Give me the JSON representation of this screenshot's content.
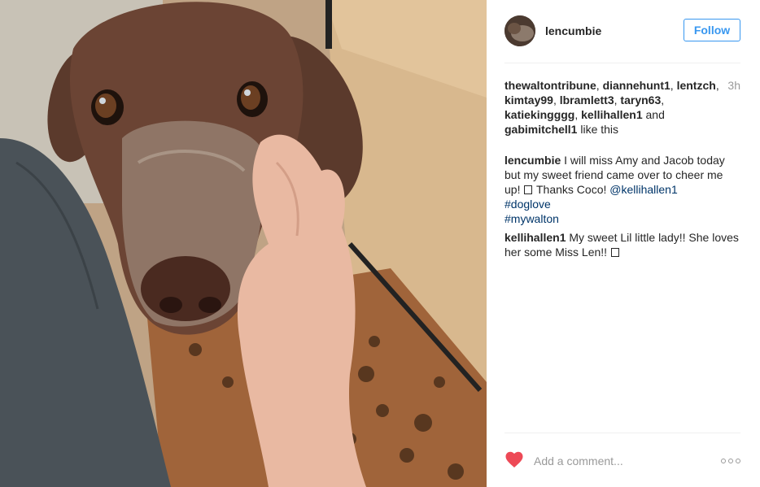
{
  "post": {
    "username": "lencumbie",
    "follow_label": "Follow",
    "time": "3h",
    "likes": {
      "users": [
        "thewaltontribune",
        "diannehunt1",
        "lentzch",
        "kimtay99",
        "lbramlett3",
        "taryn63",
        "katiekingggg",
        "kellihallen1",
        "gabimitchell1"
      ],
      "connector": "and",
      "suffix": "like this"
    },
    "caption": {
      "username": "lencumbie",
      "text_before": "I will miss Amy and Jacob today but my sweet friend came over to cheer me up!",
      "text_after": "Thanks Coco!",
      "mention": "@kellihallen1",
      "hashtags": [
        "#doglove",
        "#mywalton"
      ]
    },
    "comments": [
      {
        "username": "kellihallen1",
        "text": "My sweet Lil little lady!! She loves her some Miss Len!!"
      }
    ],
    "add_comment_placeholder": "Add a comment...",
    "colors": {
      "accent": "#3897f0",
      "heart": "#ed4956",
      "link": "#003569"
    },
    "icons": [
      "heart-icon",
      "more-options-icon"
    ]
  }
}
